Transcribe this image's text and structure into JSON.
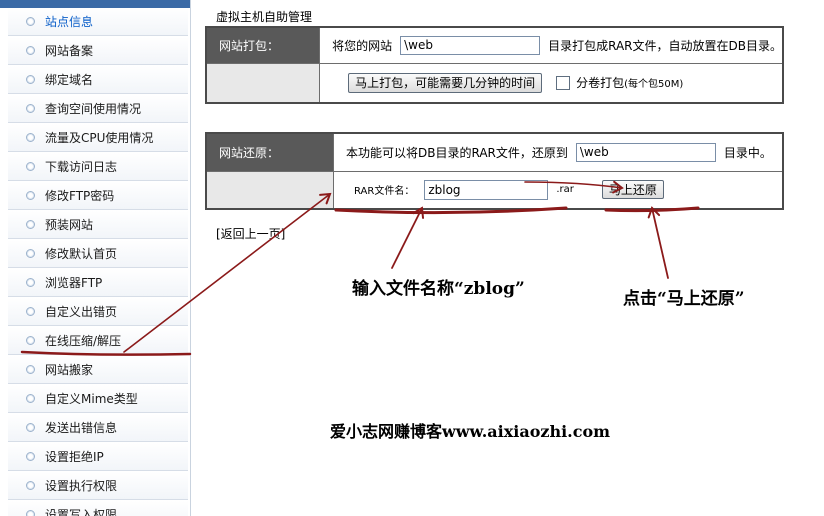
{
  "sidebar": {
    "items": [
      {
        "label": "站点信息"
      },
      {
        "label": "网站备案"
      },
      {
        "label": "绑定域名"
      },
      {
        "label": "查询空间使用情况"
      },
      {
        "label": "流量及CPU使用情况"
      },
      {
        "label": "下载访问日志"
      },
      {
        "label": "修改FTP密码"
      },
      {
        "label": "预装网站"
      },
      {
        "label": "修改默认首页"
      },
      {
        "label": "浏览器FTP"
      },
      {
        "label": "自定义出错页"
      },
      {
        "label": "在线压缩/解压"
      },
      {
        "label": "网站搬家"
      },
      {
        "label": "自定义Mime类型"
      },
      {
        "label": "发送出错信息"
      },
      {
        "label": "设置拒绝IP"
      },
      {
        "label": "设置执行权限"
      },
      {
        "label": "设置写入权限"
      }
    ],
    "active_index": 0
  },
  "page_title": "虚拟主机自助管理",
  "pack": {
    "header": "网站打包：",
    "prefix": "将您的网站",
    "path_value": "\\web",
    "suffix": "目录打包成RAR文件，自动放置在DB目录。",
    "button_label": "马上打包，可能需要几分钟的时间",
    "split_checked": false,
    "split_label": "分卷打包",
    "split_note": "(每个包50M)"
  },
  "restore": {
    "header": "网站还原：",
    "prefix": "本功能可以将DB目录的RAR文件，还原到",
    "path_value": "\\web",
    "suffix": "目录中。",
    "file_label": "RAR文件名：",
    "file_value": "zblog",
    "file_ext": ".rar",
    "button_label": "马上还原"
  },
  "back_link": "[返回上一页]",
  "annotations": {
    "input_hint": "输入文件名称“zblog”",
    "click_hint": "点击“马上还原”",
    "watermark": "爱小志网赚博客www.aixiaozhi.com",
    "color": "#8b1a1a"
  }
}
